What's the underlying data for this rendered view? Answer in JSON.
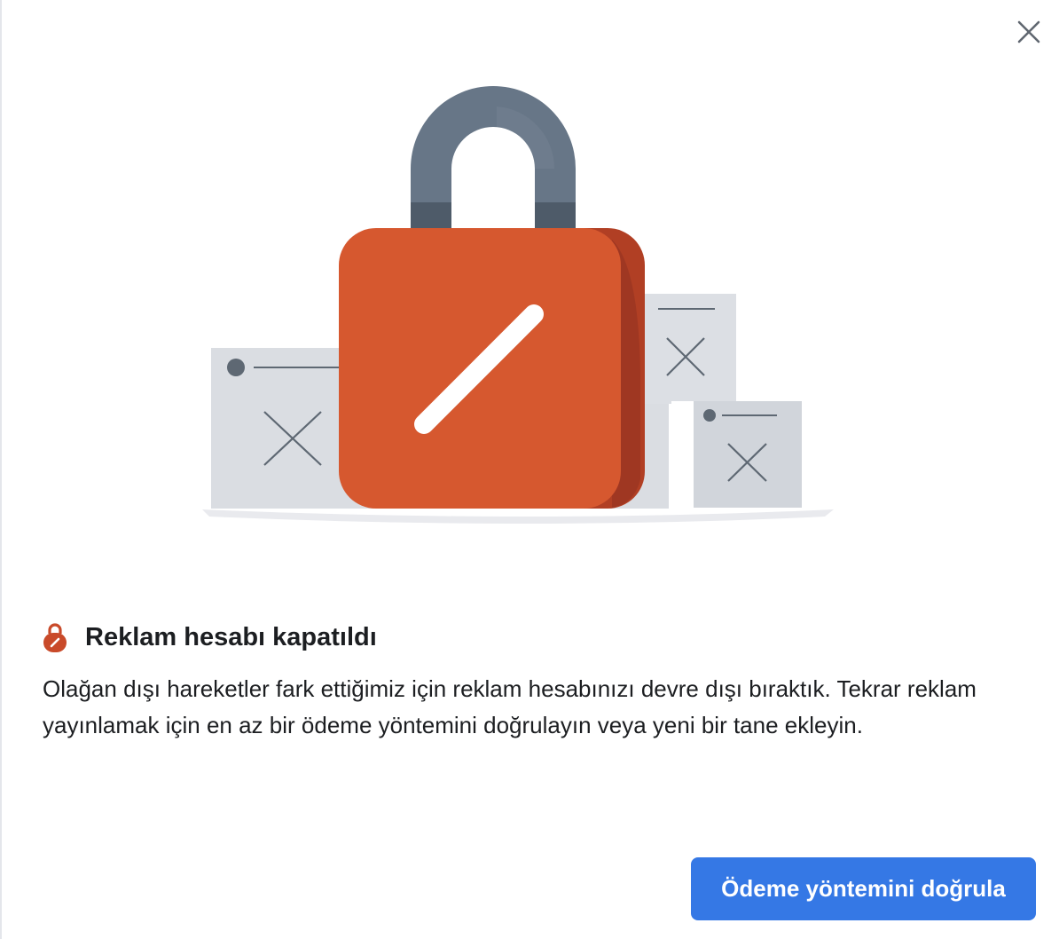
{
  "dialog": {
    "title": "Reklam hesabı kapatıldı",
    "message": "Olağan dışı hareketler fark ettiğimiz için reklam hesabınızı devre dışı bıraktık. Tekrar reklam yayınlamak için en az bir ödeme yöntemini doğrulayın veya yeni bir tane ekleyin.",
    "primary_button_label": "Ödeme yöntemini doğrula",
    "icons": {
      "close": "close-icon",
      "title": "lock-icon",
      "hero": "padlock-illustration"
    },
    "colors": {
      "accent": "#3578e5",
      "lock_body": "#d6572f",
      "lock_shackle": "#667586",
      "title_icon": "#c94a2a",
      "text": "#1c1e21"
    }
  }
}
